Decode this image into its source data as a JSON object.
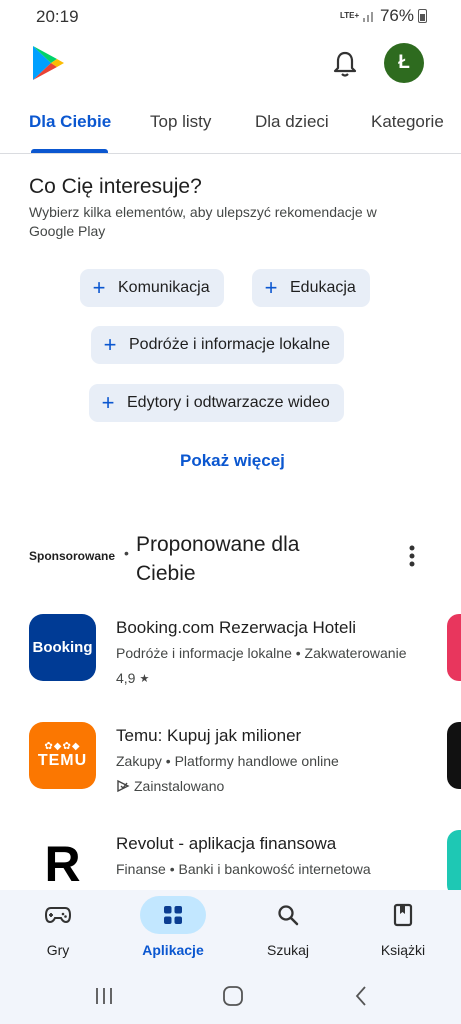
{
  "status": {
    "time": "20:19",
    "network": "LTE+",
    "battery": "76%"
  },
  "header": {
    "avatar_letter": "Ł"
  },
  "tabs": [
    {
      "label": "Dla Ciebie",
      "active": true
    },
    {
      "label": "Top listy",
      "active": false
    },
    {
      "label": "Dla dzieci",
      "active": false
    },
    {
      "label": "Kategorie",
      "active": false
    }
  ],
  "interests": {
    "title": "Co Cię interesuje?",
    "subtitle": "Wybierz kilka elementów, aby ulepszyć rekomendacje w Google Play",
    "chips": [
      {
        "label": "Komunikacja"
      },
      {
        "label": "Edukacja"
      },
      {
        "label": "Podróże i informacje lokalne"
      },
      {
        "label": "Edytory i odtwarzacze wideo"
      }
    ],
    "show_more": "Pokaż więcej"
  },
  "recommended": {
    "sponsored": "Sponsorowane",
    "separator": "•",
    "title": "Proponowane dla Ciebie",
    "apps": [
      {
        "name": "Booking.com Rezerwacja Hoteli",
        "category": "Podróże i informacje lokalne • Zakwaterowanie",
        "meta": "4,9",
        "meta_icon": "star-icon",
        "icon_text": "Booking",
        "icon_color": "#003b95"
      },
      {
        "name": "Temu: Kupuj jak milioner",
        "category": "Zakupy • Platformy handlowe online",
        "meta": "Zainstalowano",
        "meta_icon": "installed-icon",
        "icon_text": "TEMU",
        "icon_color": "#fb7701"
      },
      {
        "name": "Revolut - aplikacja finansowa",
        "category": "Finanse • Banki i bankowość internetowa",
        "meta": "",
        "meta_icon": "",
        "icon_text": "R",
        "icon_color": "#ffffff"
      }
    ]
  },
  "bottom_nav": [
    {
      "label": "Gry",
      "icon": "gamepad-icon",
      "active": false
    },
    {
      "label": "Aplikacje",
      "icon": "apps-grid-icon",
      "active": true
    },
    {
      "label": "Szukaj",
      "icon": "search-icon",
      "active": false
    },
    {
      "label": "Książki",
      "icon": "book-icon",
      "active": false
    }
  ],
  "colors": {
    "accent": "#0b57d0",
    "chip_bg": "#e8eef7",
    "avatar": "#2e6b1f",
    "nav_bg": "#f2f5fb",
    "nav_active": "#c2e7ff"
  }
}
